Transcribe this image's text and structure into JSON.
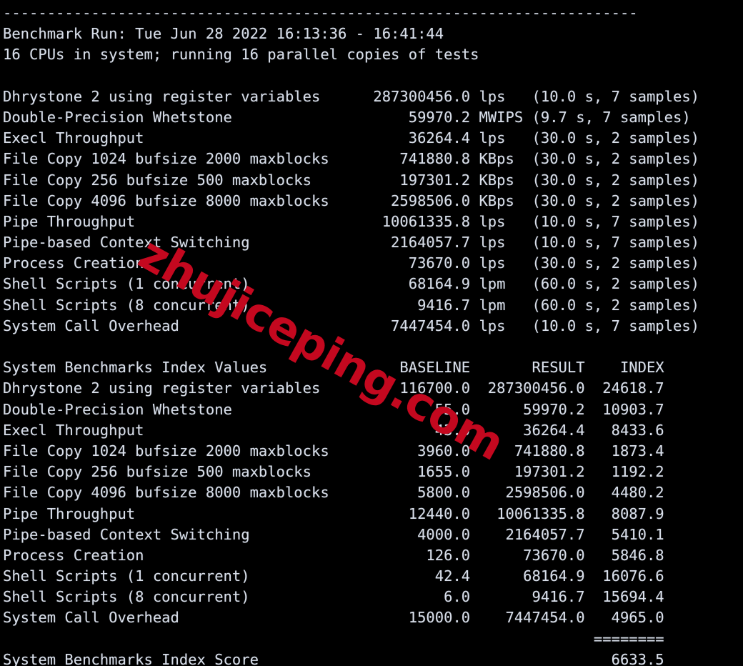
{
  "terminal": {
    "background_color": "#000000",
    "foreground_color": "#d8dee9",
    "watermark": {
      "text": "zhujiceping.com",
      "color": "#c4081f",
      "rotation_degrees": 29
    }
  },
  "report": {
    "top_rule": "------------------------------------------------------------------------",
    "run_header": "Benchmark Run: Tue Jun 28 2022 16:13:36 - 16:41:44",
    "cpu_header": "16 CPUs in system; running 16 parallel copies of tests",
    "run_date": "Tue Jun 28 2022",
    "run_start_time": "16:13:36",
    "run_end_time": "16:41:44",
    "cpu_count": "16",
    "parallel_copies": "16",
    "raw_results": [
      {
        "test": "Dhrystone 2 using register variables",
        "value": "287300456.0",
        "unit": "lps",
        "detail": "(10.0 s, 7 samples)",
        "duration": "10.0 s",
        "samples": "7"
      },
      {
        "test": "Double-Precision Whetstone",
        "value": "59970.2",
        "unit": "MWIPS",
        "detail": "(9.7 s, 7 samples)",
        "duration": "9.7 s",
        "samples": "7"
      },
      {
        "test": "Execl Throughput",
        "value": "36264.4",
        "unit": "lps",
        "detail": "(30.0 s, 2 samples)",
        "duration": "30.0 s",
        "samples": "2"
      },
      {
        "test": "File Copy 1024 bufsize 2000 maxblocks",
        "value": "741880.8",
        "unit": "KBps",
        "detail": "(30.0 s, 2 samples)",
        "duration": "30.0 s",
        "samples": "2"
      },
      {
        "test": "File Copy 256 bufsize 500 maxblocks",
        "value": "197301.2",
        "unit": "KBps",
        "detail": "(30.0 s, 2 samples)",
        "duration": "30.0 s",
        "samples": "2"
      },
      {
        "test": "File Copy 4096 bufsize 8000 maxblocks",
        "value": "2598506.0",
        "unit": "KBps",
        "detail": "(30.0 s, 2 samples)",
        "duration": "30.0 s",
        "samples": "2"
      },
      {
        "test": "Pipe Throughput",
        "value": "10061335.8",
        "unit": "lps",
        "detail": "(10.0 s, 7 samples)",
        "duration": "10.0 s",
        "samples": "7"
      },
      {
        "test": "Pipe-based Context Switching",
        "value": "2164057.7",
        "unit": "lps",
        "detail": "(10.0 s, 7 samples)",
        "duration": "10.0 s",
        "samples": "7"
      },
      {
        "test": "Process Creation",
        "value": "73670.0",
        "unit": "lps",
        "detail": "(30.0 s, 2 samples)",
        "duration": "30.0 s",
        "samples": "2"
      },
      {
        "test": "Shell Scripts (1 concurrent)",
        "value": "68164.9",
        "unit": "lpm",
        "detail": "(60.0 s, 2 samples)",
        "duration": "60.0 s",
        "samples": "2"
      },
      {
        "test": "Shell Scripts (8 concurrent)",
        "value": "9416.7",
        "unit": "lpm",
        "detail": "(60.0 s, 2 samples)",
        "duration": "60.0 s",
        "samples": "2"
      },
      {
        "test": "System Call Overhead",
        "value": "7447454.0",
        "unit": "lps",
        "detail": "(10.0 s, 7 samples)",
        "duration": "10.0 s",
        "samples": "7"
      }
    ],
    "index_table": {
      "title": "System Benchmarks Index Values",
      "columns": [
        "BASELINE",
        "RESULT",
        "INDEX"
      ],
      "rows": [
        {
          "test": "Dhrystone 2 using register variables",
          "baseline": "116700.0",
          "result": "287300456.0",
          "index": "24618.7"
        },
        {
          "test": "Double-Precision Whetstone",
          "baseline": "55.0",
          "result": "59970.2",
          "index": "10903.7"
        },
        {
          "test": "Execl Throughput",
          "baseline": "43.0",
          "result": "36264.4",
          "index": "8433.6"
        },
        {
          "test": "File Copy 1024 bufsize 2000 maxblocks",
          "baseline": "3960.0",
          "result": "741880.8",
          "index": "1873.4"
        },
        {
          "test": "File Copy 256 bufsize 500 maxblocks",
          "baseline": "1655.0",
          "result": "197301.2",
          "index": "1192.2"
        },
        {
          "test": "File Copy 4096 bufsize 8000 maxblocks",
          "baseline": "5800.0",
          "result": "2598506.0",
          "index": "4480.2"
        },
        {
          "test": "Pipe Throughput",
          "baseline": "12440.0",
          "result": "10061335.8",
          "index": "8087.9"
        },
        {
          "test": "Pipe-based Context Switching",
          "baseline": "4000.0",
          "result": "2164057.7",
          "index": "5410.1"
        },
        {
          "test": "Process Creation",
          "baseline": "126.0",
          "result": "73670.0",
          "index": "5846.8"
        },
        {
          "test": "Shell Scripts (1 concurrent)",
          "baseline": "42.4",
          "result": "68164.9",
          "index": "16076.6"
        },
        {
          "test": "Shell Scripts (8 concurrent)",
          "baseline": "6.0",
          "result": "9416.7",
          "index": "15694.4"
        },
        {
          "test": "System Call Overhead",
          "baseline": "15000.0",
          "result": "7447454.0",
          "index": "4965.0"
        }
      ],
      "separator": "========",
      "score_label": "System Benchmarks Index Score",
      "score_value": "6633.5"
    }
  },
  "lines": [
    "------------------------------------------------------------------------",
    "Benchmark Run: Tue Jun 28 2022 16:13:36 - 16:41:44",
    "16 CPUs in system; running 16 parallel copies of tests",
    "",
    "Dhrystone 2 using register variables      287300456.0 lps   (10.0 s, 7 samples)",
    "Double-Precision Whetstone                    59970.2 MWIPS (9.7 s, 7 samples)",
    "Execl Throughput                              36264.4 lps   (30.0 s, 2 samples)",
    "File Copy 1024 bufsize 2000 maxblocks        741880.8 KBps  (30.0 s, 2 samples)",
    "File Copy 256 bufsize 500 maxblocks          197301.2 KBps  (30.0 s, 2 samples)",
    "File Copy 4096 bufsize 8000 maxblocks       2598506.0 KBps  (30.0 s, 2 samples)",
    "Pipe Throughput                            10061335.8 lps   (10.0 s, 7 samples)",
    "Pipe-based Context Switching                2164057.7 lps   (10.0 s, 7 samples)",
    "Process Creation                              73670.0 lps   (30.0 s, 2 samples)",
    "Shell Scripts (1 concurrent)                  68164.9 lpm   (60.0 s, 2 samples)",
    "Shell Scripts (8 concurrent)                   9416.7 lpm   (60.0 s, 2 samples)",
    "System Call Overhead                        7447454.0 lps   (10.0 s, 7 samples)",
    "",
    "System Benchmarks Index Values               BASELINE       RESULT    INDEX",
    "Dhrystone 2 using register variables         116700.0  287300456.0  24618.7",
    "Double-Precision Whetstone                       55.0      59970.2  10903.7",
    "Execl Throughput                                 43.0      36264.4   8433.6",
    "File Copy 1024 bufsize 2000 maxblocks          3960.0     741880.8   1873.4",
    "File Copy 256 bufsize 500 maxblocks            1655.0     197301.2   1192.2",
    "File Copy 4096 bufsize 8000 maxblocks          5800.0    2598506.0   4480.2",
    "Pipe Throughput                               12440.0   10061335.8   8087.9",
    "Pipe-based Context Switching                   4000.0    2164057.7   5410.1",
    "Process Creation                                126.0      73670.0   5846.8",
    "Shell Scripts (1 concurrent)                     42.4      68164.9  16076.6",
    "Shell Scripts (8 concurrent)                      6.0       9416.7  15694.4",
    "System Call Overhead                          15000.0    7447454.0   4965.0",
    "                                                                   ========",
    "System Benchmarks Index Score                                        6633.5"
  ]
}
